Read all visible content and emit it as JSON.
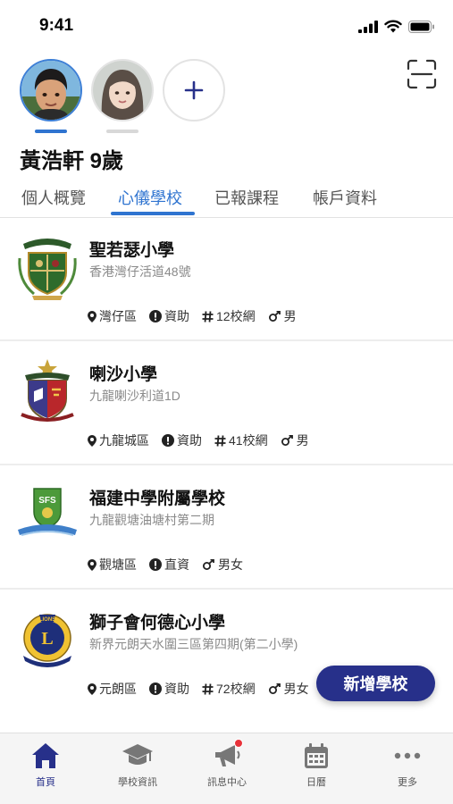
{
  "status_bar": {
    "time": "9:41"
  },
  "profile": {
    "child_name": "黃浩軒 9歲",
    "avatars": [
      {
        "name": "boy-avatar",
        "active": true
      },
      {
        "name": "girl-avatar",
        "active": false
      }
    ],
    "add_icon": "plus-icon",
    "scan_icon": "scan-icon"
  },
  "tabs": [
    {
      "label": "個人概覽",
      "active": false
    },
    {
      "label": "心儀學校",
      "active": true
    },
    {
      "label": "已報課程",
      "active": false
    },
    {
      "label": "帳戶資料",
      "active": false
    }
  ],
  "schools": [
    {
      "name": "聖若瑟小學",
      "address": "香港灣仔活道48號",
      "district": "灣仔區",
      "funding": "資助",
      "net": "12校網",
      "gender": "男"
    },
    {
      "name": "喇沙小學",
      "address": "九龍喇沙利道1D",
      "district": "九龍城區",
      "funding": "資助",
      "net": "41校網",
      "gender": "男"
    },
    {
      "name": "福建中學附屬學校",
      "address": "九龍觀塘油塘村第二期",
      "district": "觀塘區",
      "funding": "直資",
      "net": "",
      "gender": "男女",
      "logo_text": "SFS"
    },
    {
      "name": "獅子會何德心小學",
      "address": "新界元朗天水圍三區第四期(第二小學)",
      "district": "元朗區",
      "funding": "資助",
      "net": "72校網",
      "gender": "男女",
      "logo_text": "LIONS"
    }
  ],
  "fab": {
    "label": "新增學校"
  },
  "bottom_nav": [
    {
      "label": "首頁",
      "icon": "home-icon",
      "active": true
    },
    {
      "label": "學校資訊",
      "icon": "graduation-cap-icon",
      "active": false
    },
    {
      "label": "訊息中心",
      "icon": "megaphone-icon",
      "active": false,
      "badge": true
    },
    {
      "label": "日曆",
      "icon": "calendar-icon",
      "active": false
    },
    {
      "label": "更多",
      "icon": "more-dots-icon",
      "active": false
    }
  ],
  "colors": {
    "accent": "#2f74d0",
    "brand_dark": "#27308a",
    "badge": "#e8323a",
    "muted_text": "#8a8a8a"
  }
}
